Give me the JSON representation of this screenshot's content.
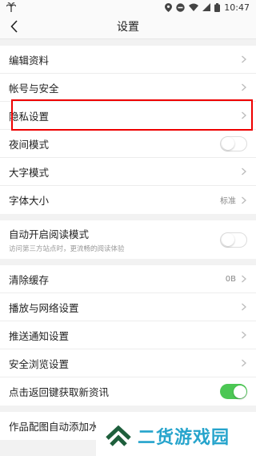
{
  "status_bar": {
    "time": "10:47"
  },
  "header": {
    "title": "设置"
  },
  "section1": {
    "edit_profile": "编辑资料",
    "account_security": "帐号与安全",
    "privacy_settings": "隐私设置",
    "night_mode": "夜间模式",
    "large_font_mode": "大字模式",
    "font_size": "字体大小",
    "font_size_value": "标准"
  },
  "section2": {
    "auto_reading_mode": "自动开启阅读模式",
    "auto_reading_mode_desc": "访问第三方站点时，更流畅的阅读体验"
  },
  "section3": {
    "clear_cache": "清除缓存",
    "clear_cache_value": "0B",
    "playback_network": "播放与网络设置",
    "push_notifications": "推送通知设置",
    "safe_browsing": "安全浏览设置",
    "back_refresh": "点击返回键获取新资讯"
  },
  "section4": {
    "watermark_setting": "作品配图自动添加水印"
  },
  "toggles": {
    "night_mode_on": false,
    "auto_reading_mode_on": false,
    "back_refresh_on": true
  },
  "watermark": {
    "text": "二货游戏园"
  },
  "colors": {
    "toggle_on": "#4cc754",
    "highlight": "#e00",
    "watermark": "#26a4cc"
  }
}
